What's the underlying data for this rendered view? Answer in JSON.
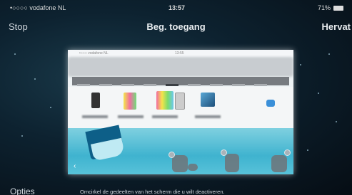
{
  "status_bar": {
    "carrier": "•○○○○ vodafone NL",
    "time": "13:57",
    "battery": "71%"
  },
  "nav": {
    "left_button": "Stop",
    "title": "Beg. toegang",
    "right_button": "Hervat"
  },
  "preview": {
    "mini_carrier": "•○○○ vodafone NL",
    "mini_time": "13:55"
  },
  "bottom": {
    "options_button": "Opties",
    "hint": "Omcirkel de gedeelten van het scherm die u wilt deactiveren."
  },
  "colors": {
    "accent": "#3fb3cf",
    "nav_bg": "#0d2230"
  },
  "icons": [
    "wifi-icon",
    "battery-icon",
    "apple-logo-icon",
    "back-arrow-icon"
  ]
}
